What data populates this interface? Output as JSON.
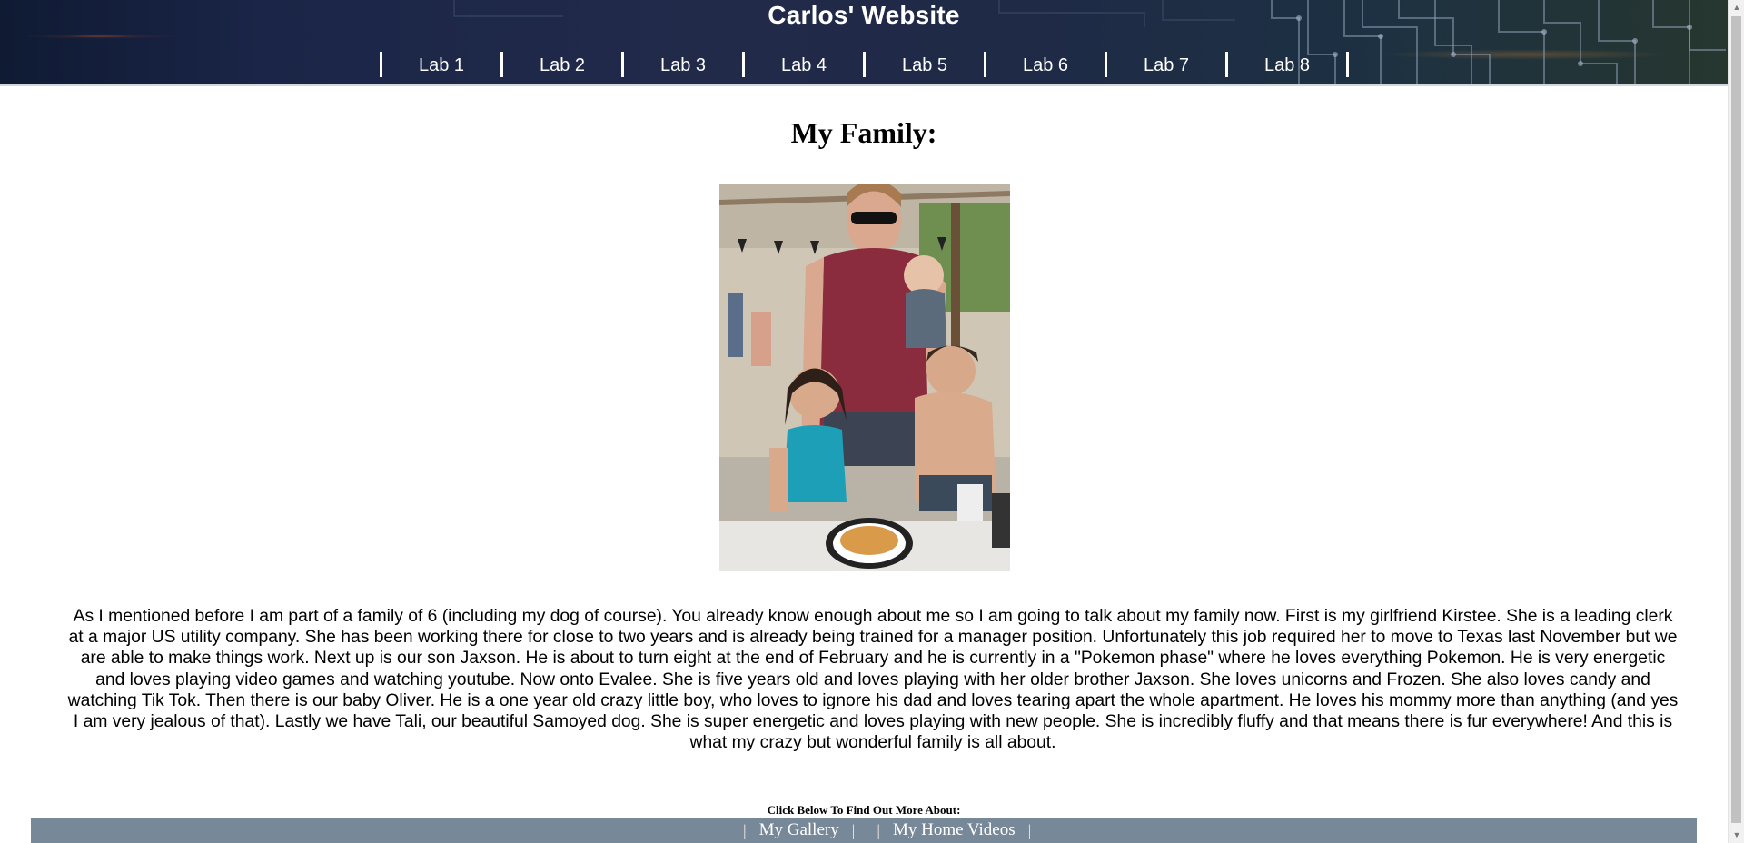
{
  "site": {
    "title": "Carlos' Website"
  },
  "nav": {
    "items": [
      "Lab 1",
      "Lab 2",
      "Lab 3",
      "Lab 4",
      "Lab 5",
      "Lab 6",
      "Lab 7",
      "Lab 8"
    ]
  },
  "main": {
    "heading": "My Family:",
    "story": "As I mentioned before I am part of a family of 6 (including my dog of course). You already know enough about me so I am going to talk about my family now. First is my girlfriend Kirstee. She is a leading clerk at a major US utility company. She has been working there for close to two years and is already being trained for a manager position. Unfortunately this job required her to move to Texas last November but we are able to make things work. Next up is our son Jaxson. He is about to turn eight at the end of February and he is currently in a \"Pokemon phase\" where he loves everything Pokemon. He is very energetic and loves playing video games and watching youtube. Now onto Evalee. She is five years old and loves playing with her older brother Jaxson. She loves unicorns and Frozen. She also loves candy and watching Tik Tok. Then there is our baby Oliver. He is a one year old crazy little boy, who loves to ignore his dad and loves tearing apart the whole apartment. He loves his mommy more than anything (and yes I am very jealous of that). Lastly we have Tali, our beautiful Samoyed dog. She is super energetic and loves playing with new people. She is incredibly fluffy and that means there is fur everywhere! And this is what my crazy but wonderful family is all about."
  },
  "footer": {
    "caption": "Click Below To Find Out More About:",
    "separator": "|",
    "links": [
      "My Gallery",
      "My Home Videos"
    ],
    "background": "#778899"
  },
  "colors": {
    "header_text": "#ffffff",
    "nav_border": "#ffffff"
  }
}
